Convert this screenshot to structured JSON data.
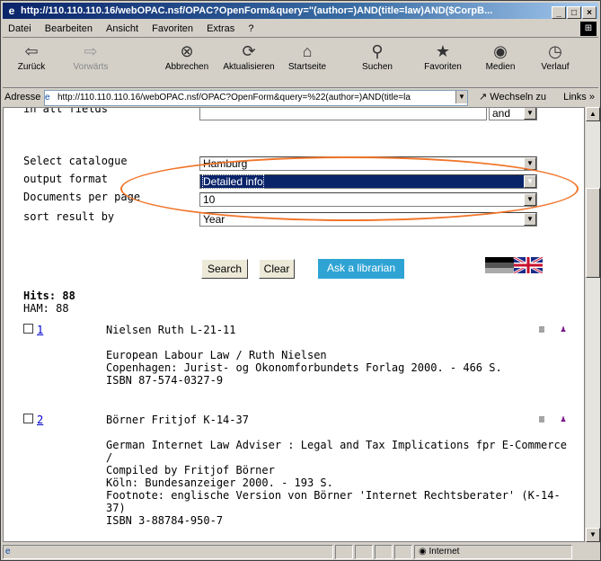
{
  "titlebar": {
    "title": "http://110.110.110.16/webOPAC.nsf/OPAC?OpenForm&query=\"(author=)AND(title=law)AND($CorpB..."
  },
  "menubar": {
    "items": [
      "Datei",
      "Bearbeiten",
      "Ansicht",
      "Favoriten",
      "Extras",
      "?"
    ]
  },
  "toolbar": {
    "back": "Zurück",
    "forward": "Vorwärts",
    "stop": "Abbrechen",
    "refresh": "Aktualisieren",
    "home": "Startseite",
    "search": "Suchen",
    "favorites": "Favoriten",
    "media": "Medien",
    "history": "Verlauf"
  },
  "addressbar": {
    "label": "Adresse",
    "url": "http://110.110.110.16/webOPAC.nsf/OPAC?OpenForm&query=%22(author=)AND(title=la",
    "go": "Wechseln zu",
    "links": "Links"
  },
  "form": {
    "top_cut_label": "in all fields",
    "top_cut_value": "and",
    "catalogue_label": "Select catalogue",
    "catalogue_value": "Hamburg",
    "format_label": "output format",
    "format_value": "Detailed info",
    "docs_label": "Documents per page",
    "docs_value": "10",
    "sort_label": "sort result by",
    "sort_value": "Year"
  },
  "buttons": {
    "search": "Search",
    "clear": "Clear",
    "ask": "Ask a librarian"
  },
  "hits": {
    "title": "Hits: 88",
    "detail": "HAM: 88"
  },
  "records": [
    {
      "num": "1",
      "heading": "Nielsen Ruth L-21-11",
      "lines": [
        "European Labour Law / Ruth Nielsen",
        "Copenhagen: Jurist- og Okonomforbundets Forlag 2000. - 466 S.",
        "ISBN 87-574-0327-9"
      ]
    },
    {
      "num": "2",
      "heading": "Börner Fritjof K-14-37",
      "lines": [
        "German Internet Law Adviser : Legal and Tax Implications fpr E-Commerce /",
        "Compiled by Fritjof Börner",
        "Köln: Bundesanzeiger 2000. - 193 S.",
        "Footnote: englische Version von Börner 'Internet Rechtsberater' (K-14-37)",
        "ISBN 3-88784-950-7"
      ]
    }
  ],
  "statusbar": {
    "zone": "Internet"
  }
}
